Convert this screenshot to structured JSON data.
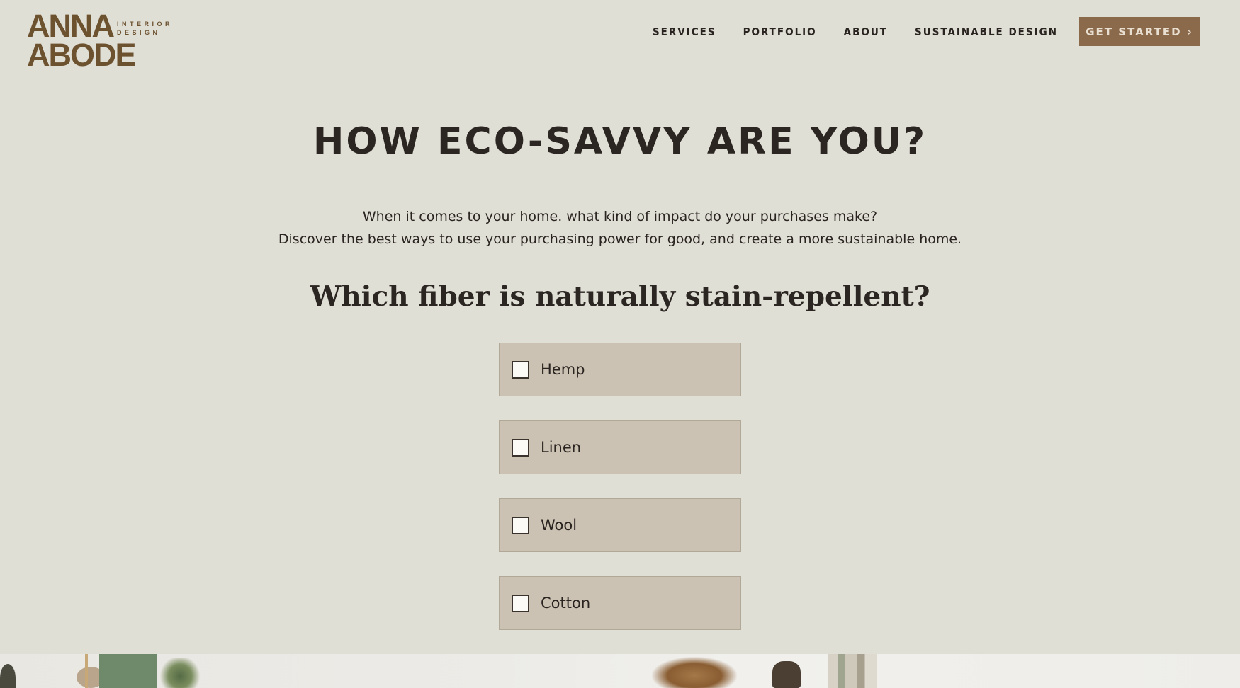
{
  "header": {
    "logo": {
      "name": "ANNA ABODE",
      "tagline": "INTERIOR DESIGN"
    },
    "nav": [
      "SERVICES",
      "PORTFOLIO",
      "ABOUT",
      "SUSTAINABLE DESIGN"
    ],
    "cta_label": "GET STARTED"
  },
  "main": {
    "title": "HOW ECO-SAVVY ARE YOU?",
    "intro_line1": "When it comes to your home. what kind of impact do your purchases make?",
    "intro_line2": "Discover the best ways to use your purchasing power for good, and create a more sustainable home.",
    "question": "Which fiber is naturally stain-repellent?",
    "options": [
      {
        "label": "Hemp",
        "checked": false
      },
      {
        "label": "Linen",
        "checked": false
      },
      {
        "label": "Wool",
        "checked": false
      },
      {
        "label": "Cotton",
        "checked": false
      }
    ]
  },
  "colors": {
    "background": "#e0dfd6",
    "cta": "#8b6a4c",
    "option_bg": "#ccc2b3",
    "logo": "#6d5230"
  }
}
